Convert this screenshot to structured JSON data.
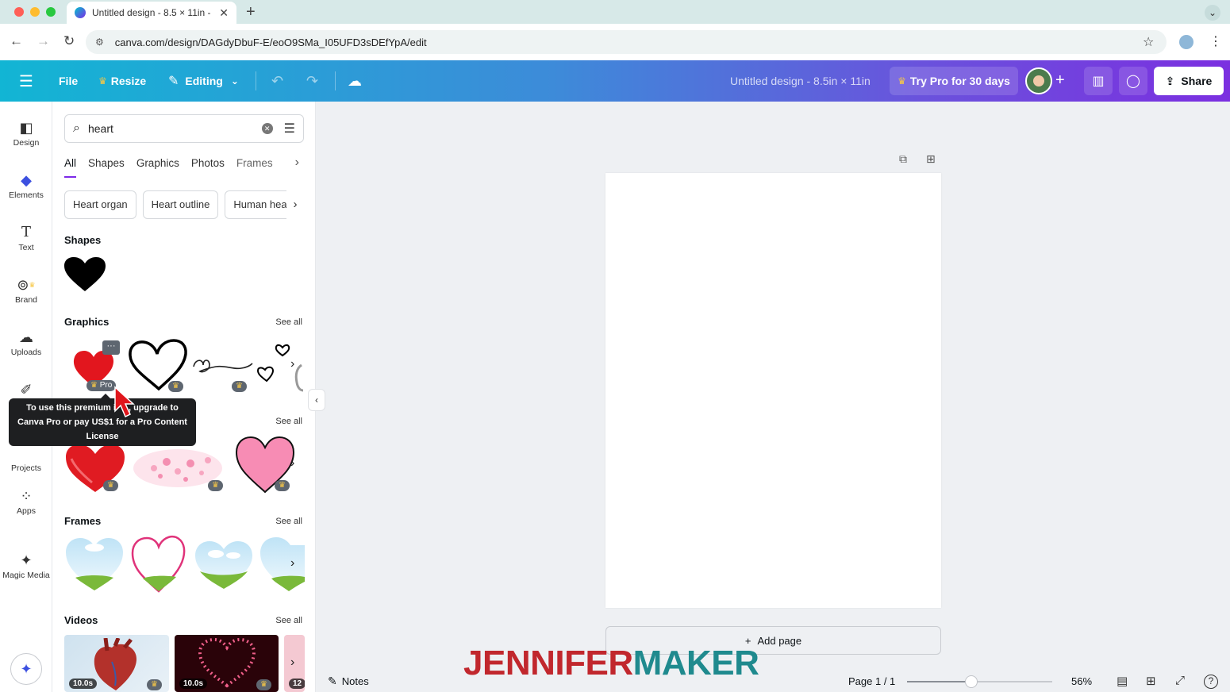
{
  "browser": {
    "tab_title": "Untitled design - 8.5 × 11in -",
    "tab_close": "✕",
    "new_tab": "+",
    "url": "canva.com/design/DAGdyDbuF-E/eoO9SMa_I05UFD3sDEfYpA/edit"
  },
  "topbar": {
    "file": "File",
    "resize": "Resize",
    "editing": "Editing",
    "doc_title": "Untitled design - 8.5in × 11in",
    "try_pro": "Try Pro for 30 days",
    "share": "Share"
  },
  "rail": {
    "items": [
      {
        "label": "Design",
        "icon": "design-icon"
      },
      {
        "label": "Elements",
        "icon": "elements-icon"
      },
      {
        "label": "Text",
        "icon": "text-icon"
      },
      {
        "label": "Brand",
        "icon": "brand-icon"
      },
      {
        "label": "Uploads",
        "icon": "uploads-icon"
      },
      {
        "label": "Projects",
        "icon": "projects-icon"
      },
      {
        "label": "Apps",
        "icon": "apps-icon"
      },
      {
        "label": "Magic Media",
        "icon": "magic-media-icon"
      }
    ],
    "active": "Elements"
  },
  "panel": {
    "search_value": "heart",
    "tabs": [
      "All",
      "Shapes",
      "Graphics",
      "Photos",
      "Frames"
    ],
    "active_tab": "All",
    "chips": [
      "Heart organ",
      "Heart outline",
      "Human hea"
    ],
    "sections": {
      "shapes": "Shapes",
      "graphics": "Graphics",
      "frames": "Frames",
      "videos": "Videos",
      "see_all": "See all"
    },
    "pro_label": "Pro",
    "tooltip": {
      "line1": "To use this premium i",
      "line1b": ", upgrade to",
      "line2": "Canva Pro or pay US$1 for a Pro Content",
      "line3": "License"
    },
    "videos": [
      {
        "length": "10.0s"
      },
      {
        "length": "10.0s"
      },
      {
        "length": "12"
      }
    ]
  },
  "canvas": {
    "add_page": "Add page",
    "watermark_a": "JENNIFER",
    "watermark_b": "MAKER"
  },
  "bottombar": {
    "notes": "Notes",
    "page": "Page 1 / 1",
    "zoom_percent": 56,
    "zoom_label": "56%"
  },
  "colors": {
    "accent": "#7d2ae8",
    "crown": "#f7c847",
    "watermark_red": "#c1272d",
    "watermark_teal": "#1f8a8e"
  }
}
